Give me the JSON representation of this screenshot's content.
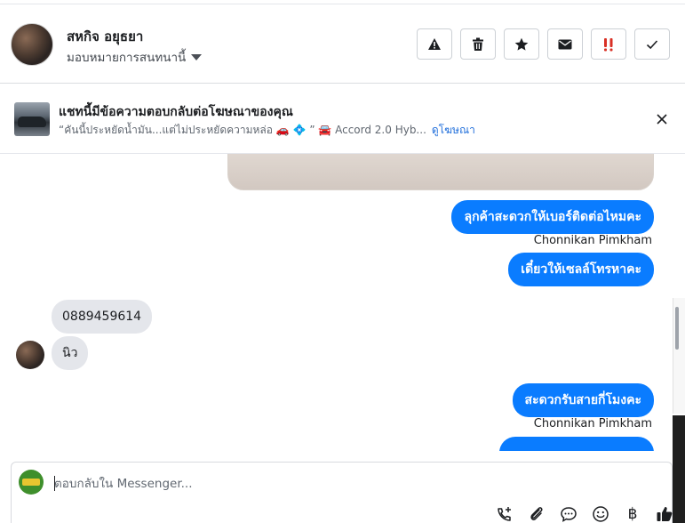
{
  "header": {
    "contact_name": "สหกิจ อยุธยา",
    "assign_label": "มอบหมายการสนทนานี้",
    "actions": [
      {
        "name": "report-icon"
      },
      {
        "name": "trash-icon"
      },
      {
        "name": "star-icon"
      },
      {
        "name": "mail-icon"
      },
      {
        "name": "important-icon"
      },
      {
        "name": "check-icon"
      }
    ]
  },
  "ad_banner": {
    "title": "แชทนี้มีข้อความตอบกลับต่อโฆษณาของคุณ",
    "snippet": "“คันนี้ประหยัดน้ำมัน...แต่ไม่ประหยัดความหล่อ 🚗 💠 ” 🚘 Accord 2.0 Hyb...",
    "link_label": "ดูโฆษณา"
  },
  "thread": {
    "messages": [
      {
        "dir": "out",
        "text": "ลุกค้าสะดวกให้เบอร์ติดต่อไหมคะ"
      },
      {
        "dir": "out-sender",
        "text": "Chonnikan Pimkham"
      },
      {
        "dir": "out",
        "text": "เดี๋ยวให้เซลล์โทรหาคะ"
      },
      {
        "dir": "in",
        "text": "0889459614"
      },
      {
        "dir": "in",
        "text": "นิว"
      },
      {
        "dir": "out",
        "text": "สะดวกรับสายกี่โมงคะ"
      },
      {
        "dir": "out-sender",
        "text": "Chonnikan Pimkham"
      }
    ]
  },
  "composer": {
    "placeholder": "ตอบกลับใน Messenger...",
    "tools": [
      "call-add-icon",
      "attachment-icon",
      "saved-reply-icon",
      "emoji-icon",
      "baht-icon",
      "like-icon"
    ],
    "baht_symbol": "฿"
  },
  "colors": {
    "bubble_out": "#0a7cff",
    "bubble_in": "#e4e6eb",
    "link": "#216fdb",
    "important": "#d93025"
  }
}
